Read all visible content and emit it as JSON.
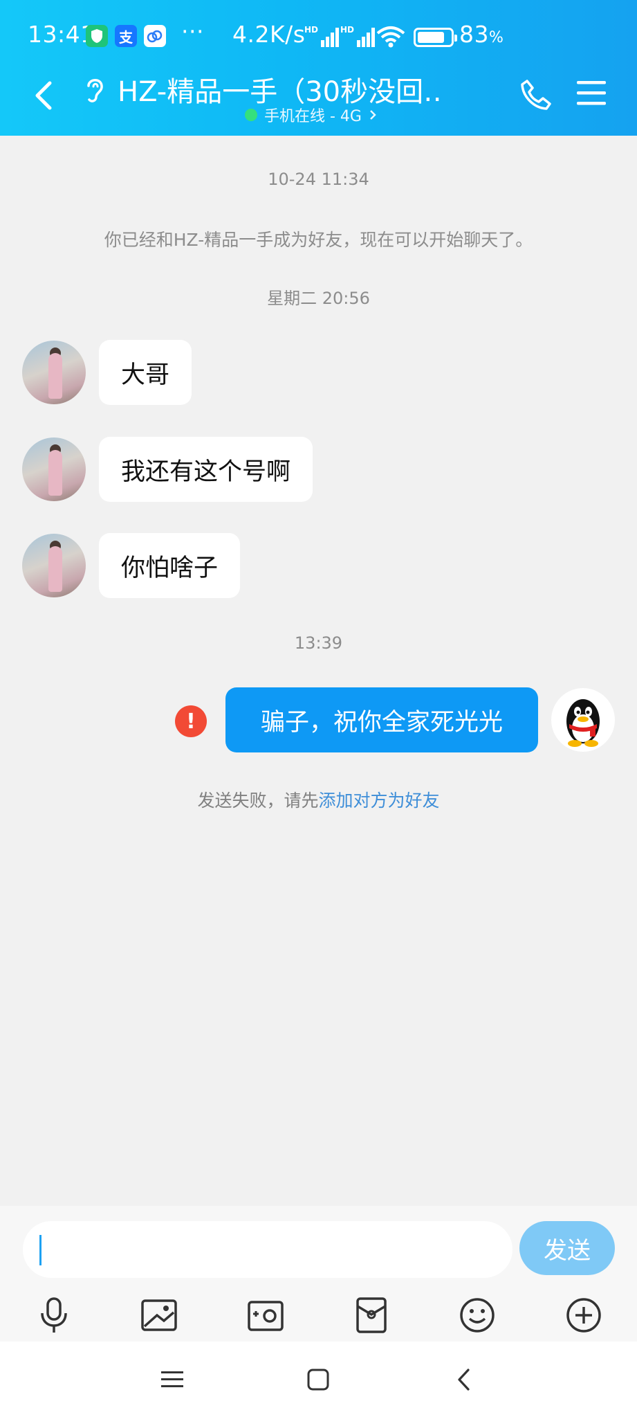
{
  "status_bar": {
    "time": "13:41",
    "net_speed": "4.2K/s",
    "hd1": "HD",
    "hd2": "HD",
    "battery": "83",
    "battery_unit": "%",
    "more": "···",
    "alipay_icon_char": "支",
    "battery_level": 0.83
  },
  "header": {
    "title": "HZ-精品一手（30秒没回…",
    "subtitle": "手机在线 - 4G",
    "online_color": "#35e07d"
  },
  "chat": {
    "timestamp1": "10-24 11:34",
    "friend_notice": "你已经和HZ-精品一手成为好友，现在可以开始聊天了。",
    "timestamp2": "星期二 20:56",
    "incoming": [
      {
        "text": "大哥"
      },
      {
        "text": "我还有这个号啊"
      },
      {
        "text": "你怕啥子"
      }
    ],
    "timestamp3": "13:39",
    "outgoing_text": "骗子，祝你全家死光光",
    "error_mark": "!",
    "fail_note": "发送失败，请先",
    "fail_link": "添加对方为好友"
  },
  "input": {
    "send_label": "发送",
    "tools": [
      "microphone-icon",
      "image-icon",
      "camera-icon",
      "red-envelope-icon",
      "emoji-icon",
      "plus-icon"
    ]
  },
  "colors": {
    "header_gradient_start": "#14c8f9",
    "header_gradient_end": "#15a2f0",
    "outgoing_bubble": "#0e99f5",
    "send_button": "#7fc9f6",
    "error": "#f24a35",
    "link": "#3e8ed8"
  }
}
